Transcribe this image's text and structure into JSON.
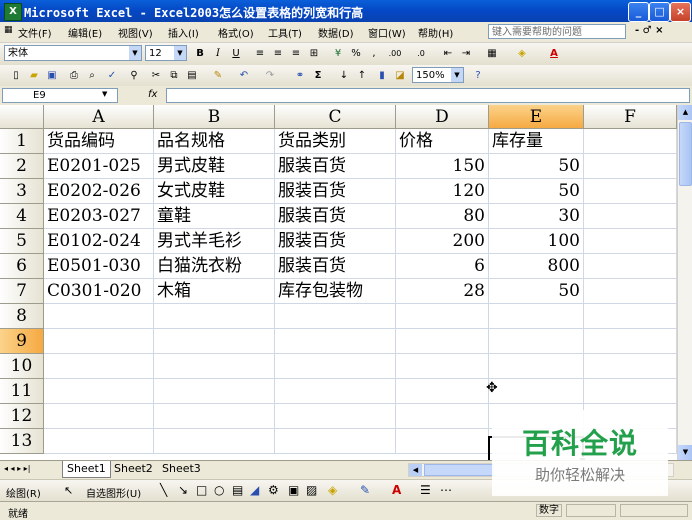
{
  "window": {
    "title": "Microsoft Excel - Excel2003怎么设置表格的列宽和行高",
    "minimize": "_",
    "maximize": "□",
    "close": "×"
  },
  "menu": {
    "items": [
      "文件(F)",
      "编辑(E)",
      "视图(V)",
      "插入(I)",
      "格式(O)",
      "工具(T)",
      "数据(D)",
      "窗口(W)",
      "帮助(H)"
    ],
    "help_placeholder": "键入需要帮助的问题",
    "doc_controls": "- ♂ ×"
  },
  "format_toolbar": {
    "font": "宋体",
    "size": "12",
    "bold": "B",
    "italic": "I",
    "underline": "U",
    "percent": "%",
    "comma": ",",
    "inc_decimal": ".00",
    "dec_decimal": ".0"
  },
  "standard_toolbar": {
    "zoom": "150%",
    "sigma": "Σ"
  },
  "formula_bar": {
    "name_box": "E9",
    "fx": "fx",
    "content": ""
  },
  "sheet": {
    "columns": [
      "A",
      "B",
      "C",
      "D",
      "E",
      "F"
    ],
    "selected_column": "E",
    "rows": [
      "1",
      "2",
      "3",
      "4",
      "5",
      "6",
      "7",
      "8",
      "9",
      "10",
      "11",
      "12",
      "13"
    ],
    "selected_row": "9",
    "cells": [
      [
        "货品编码",
        "品名规格",
        "货品类别",
        "价格",
        "库存量",
        ""
      ],
      [
        "E0201-025",
        "男式皮鞋",
        "服装百货",
        "150",
        "50",
        ""
      ],
      [
        "E0202-026",
        "女式皮鞋",
        "服装百货",
        "120",
        "50",
        ""
      ],
      [
        "E0203-027",
        "童鞋",
        "服装百货",
        "80",
        "30",
        ""
      ],
      [
        "E0102-024",
        "男式羊毛衫",
        "服装百货",
        "200",
        "100",
        ""
      ],
      [
        "E0501-030",
        "白猫洗衣粉",
        "服装百货",
        "6",
        "800",
        ""
      ],
      [
        "C0301-020",
        "木箱",
        "库存包装物",
        "28",
        "50",
        ""
      ],
      [
        "",
        "",
        "",
        "",
        "",
        ""
      ],
      [
        "",
        "",
        "",
        "",
        "",
        ""
      ],
      [
        "",
        "",
        "",
        "",
        "",
        ""
      ],
      [
        "",
        "",
        "",
        "",
        "",
        ""
      ],
      [
        "",
        "",
        "",
        "",
        "",
        ""
      ],
      [
        "",
        "",
        "",
        "",
        "",
        ""
      ]
    ],
    "active_cell": "E9"
  },
  "tabs": {
    "nav": "◂ ◂ ▸ ▸|",
    "sheets": [
      "Sheet1",
      "Sheet2",
      "Sheet3"
    ],
    "active": "Sheet1"
  },
  "draw_toolbar": {
    "draw": "绘图(R)",
    "autoshapes": "自选图形(U)"
  },
  "status": {
    "ready": "就绪",
    "numlock": "数字"
  },
  "watermark": {
    "title": "百科全说",
    "subtitle": "助你轻松解决"
  }
}
